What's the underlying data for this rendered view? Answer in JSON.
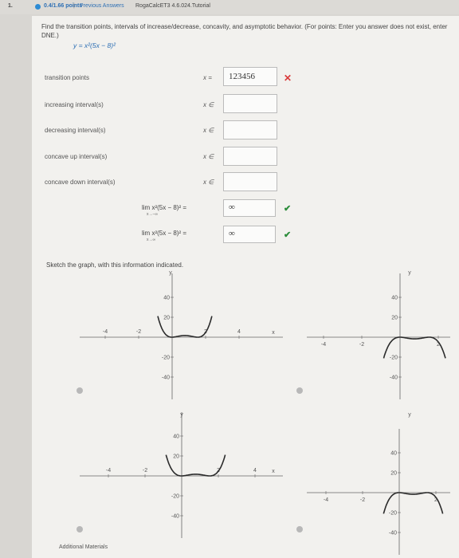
{
  "header": {
    "question_number": "1.",
    "points": "0.4/1.66 points",
    "separator": "|",
    "previous_answers": "Previous Answers",
    "identifier": "RogaCalcET3 4.6.024.Tutorial"
  },
  "instructions": "Find the transition points, intervals of increase/decrease, concavity, and asymptotic behavior. (For points: Enter you answer does not exist, enter DNE.)",
  "function": "y = x²(5x − 8)²",
  "rows": [
    {
      "label": "transition points",
      "prefix": "x =",
      "value": "123456",
      "status": "incorrect"
    },
    {
      "label": "increasing interval(s)",
      "prefix": "x ∈",
      "value": ""
    },
    {
      "label": "decreasing interval(s)",
      "prefix": "x ∈",
      "value": ""
    },
    {
      "label": "concave up interval(s)",
      "prefix": "x ∈",
      "value": ""
    },
    {
      "label": "concave down interval(s)",
      "prefix": "x ∈",
      "value": ""
    }
  ],
  "limits": [
    {
      "text": "lim x²(5x − 8)² =",
      "sub": "x→−∞",
      "value": "∞",
      "status": "correct"
    },
    {
      "text": "lim x²(5x − 8)² =",
      "sub": "x→∞",
      "value": "∞",
      "status": "correct"
    }
  ],
  "sketch_prompt": "Sketch the graph, with this information indicated.",
  "graphs": {
    "axis_x": "x",
    "axis_y": "y",
    "tick_40": "40",
    "tick_20": "20",
    "tick_m20": "-20",
    "tick_m40": "-40",
    "tick_m4": "-4",
    "tick_m2": "-2",
    "tick_2": "2",
    "tick_4": "4"
  },
  "colors": {
    "curve": "#2b2b2b",
    "axis": "#666666",
    "grid": "#cfcfcf",
    "cross": "#d93a3a",
    "check": "#2b8c3a"
  },
  "footer": {
    "additional_materials": "Additional Materials"
  }
}
